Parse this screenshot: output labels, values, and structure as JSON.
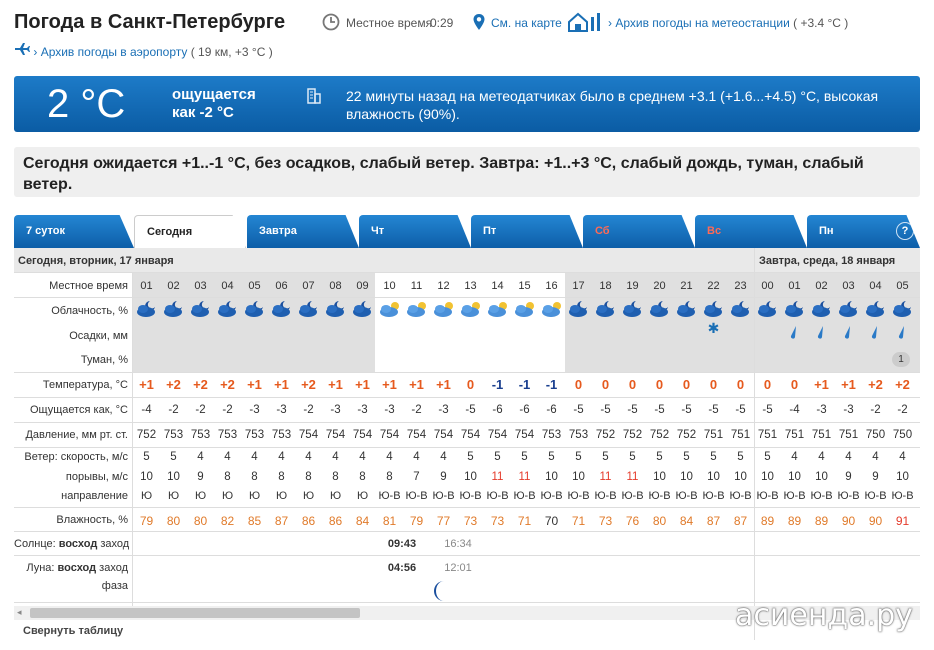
{
  "header": {
    "title": "Погода в Санкт-Петербурге",
    "local_time_label": "Местное время",
    "local_time": "0:29",
    "map_link": "См. на карте",
    "archive_station": "Архив погоды на метеостанции",
    "archive_station_temp": "( +3.4 °C )",
    "archive_airport": "Архив погоды в аэропорту",
    "archive_airport_info": "( 19 км, +3 °C )"
  },
  "now": {
    "temp": "2 °C",
    "feels_line1": "ощущается",
    "feels_line2": "как -2 °C",
    "sensor_text": "22 минуты назад на метеодатчиках было в среднем +3.1 (+1.6...+4.5) °C, высокая влажность (90%)."
  },
  "forecast_text": "Сегодня ожидается +1..-1 °C, без осадков, слабый ветер. Завтра: +1..+3 °C, слабый дождь, туман, слабый ветер.",
  "tabs": [
    "7 суток",
    "Сегодня",
    "Завтра",
    "Чт",
    "Пт",
    "Сб",
    "Вс",
    "Пн"
  ],
  "help_icon": "?",
  "table": {
    "day1": "Сегодня, вторник, 17 января",
    "day2": "Завтра, среда, 18 января",
    "labels": {
      "time": "Местное время",
      "cloud": "Облачность, %",
      "precip": "Осадки, мм",
      "fog": "Туман, %",
      "temp": "Температура, °C",
      "feels": "Ощущается как, °C",
      "pressure": "Давление, мм рт. ст.",
      "wind": "Ветер: скорость, м/с",
      "gusts": "порывы, м/с",
      "direction": "направление",
      "humidity": "Влажность, %",
      "sun_pre": "Солнце: ",
      "sun_rise": "восход",
      "sun_set": " заход",
      "moon_pre": "Луна: ",
      "moon_rise": "восход",
      "moon_set": " заход",
      "phase": "фаза"
    },
    "hours": [
      "01",
      "02",
      "03",
      "04",
      "05",
      "06",
      "07",
      "08",
      "09",
      "10",
      "11",
      "12",
      "13",
      "14",
      "15",
      "16",
      "17",
      "18",
      "19",
      "20",
      "21",
      "22",
      "23",
      "00",
      "01",
      "02",
      "03",
      "04",
      "05"
    ],
    "temp": [
      "+1",
      "+2",
      "+2",
      "+2",
      "+1",
      "+1",
      "+2",
      "+1",
      "+1",
      "+1",
      "+1",
      "+1",
      "0",
      "-1",
      "-1",
      "-1",
      "0",
      "0",
      "0",
      "0",
      "0",
      "0",
      "0",
      "0",
      "0",
      "+1",
      "+1",
      "+2",
      "+2"
    ],
    "feels": [
      "-4",
      "-2",
      "-2",
      "-2",
      "-3",
      "-3",
      "-2",
      "-3",
      "-3",
      "-3",
      "-2",
      "-3",
      "-5",
      "-6",
      "-6",
      "-6",
      "-5",
      "-5",
      "-5",
      "-5",
      "-5",
      "-5",
      "-5",
      "-5",
      "-4",
      "-3",
      "-3",
      "-2",
      "-2"
    ],
    "pressure": [
      "752",
      "753",
      "753",
      "753",
      "753",
      "753",
      "754",
      "754",
      "754",
      "754",
      "754",
      "754",
      "754",
      "754",
      "754",
      "753",
      "753",
      "752",
      "752",
      "752",
      "752",
      "751",
      "751",
      "751",
      "751",
      "751",
      "751",
      "750",
      "750"
    ],
    "wind": [
      "5",
      "5",
      "4",
      "4",
      "4",
      "4",
      "4",
      "4",
      "4",
      "4",
      "4",
      "4",
      "5",
      "5",
      "5",
      "5",
      "5",
      "5",
      "5",
      "5",
      "5",
      "5",
      "5",
      "5",
      "4",
      "4",
      "4",
      "4",
      "4"
    ],
    "gusts": [
      "10",
      "10",
      "9",
      "8",
      "8",
      "8",
      "8",
      "8",
      "8",
      "8",
      "7",
      "9",
      "10",
      "11",
      "11",
      "10",
      "10",
      "11",
      "11",
      "10",
      "10",
      "10",
      "10",
      "10",
      "10",
      "10",
      "9",
      "9",
      "10"
    ],
    "direction": [
      "Ю",
      "Ю",
      "Ю",
      "Ю",
      "Ю",
      "Ю",
      "Ю",
      "Ю",
      "Ю",
      "Ю-В",
      "Ю-В",
      "Ю-В",
      "Ю-В",
      "Ю-В",
      "Ю-В",
      "Ю-В",
      "Ю-В",
      "Ю-В",
      "Ю-В",
      "Ю-В",
      "Ю-В",
      "Ю-В",
      "Ю-В",
      "Ю-В",
      "Ю-В",
      "Ю-В",
      "Ю-В",
      "Ю-В",
      "Ю-В"
    ],
    "humidity": [
      "79",
      "80",
      "80",
      "82",
      "85",
      "87",
      "86",
      "86",
      "84",
      "81",
      "79",
      "77",
      "73",
      "73",
      "71",
      "70",
      "71",
      "73",
      "76",
      "80",
      "84",
      "87",
      "87",
      "89",
      "89",
      "89",
      "90",
      "90",
      "91"
    ],
    "sunrise": "09:43",
    "sunset": "16:34",
    "moonrise": "04:56",
    "moonset": "12:01",
    "fog_value": "1",
    "colors": {
      "warm": "#e65a1e",
      "cold": "#1a3f8f",
      "humidity": "#e07a2a",
      "header_blue": "#0b5ca4"
    }
  },
  "collapse": "Свернуть таблицу",
  "watermark": "асиенда.ру"
}
